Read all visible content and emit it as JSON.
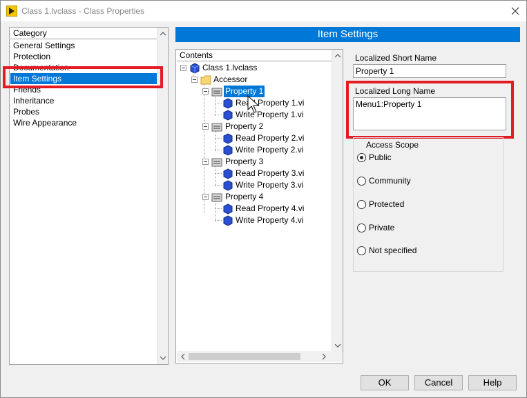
{
  "window": {
    "title": "Class 1.lvclass - Class Properties"
  },
  "category": {
    "header": "Category",
    "items": [
      {
        "label": "General Settings"
      },
      {
        "label": "Protection"
      },
      {
        "label": "Documentation"
      },
      {
        "label": "Item Settings",
        "selected": true
      },
      {
        "label": "Friends"
      },
      {
        "label": "Inheritance"
      },
      {
        "label": "Probes"
      },
      {
        "label": "Wire Appearance"
      }
    ]
  },
  "banner": {
    "title": "Item Settings"
  },
  "contents": {
    "header": "Contents",
    "tree": [
      {
        "label": "Class 1.lvclass",
        "icon": "lvclass-icon"
      },
      {
        "label": "Accessor",
        "icon": "folder-icon"
      },
      {
        "label": "Property 1",
        "icon": "property-folder-icon",
        "selected": true
      },
      {
        "label": "Read Property 1.vi",
        "icon": "vi-icon"
      },
      {
        "label": "Write Property 1.vi",
        "icon": "vi-icon"
      },
      {
        "label": "Property 2",
        "icon": "property-folder-icon"
      },
      {
        "label": "Read Property 2.vi",
        "icon": "vi-icon"
      },
      {
        "label": "Write Property 2.vi",
        "icon": "vi-icon"
      },
      {
        "label": "Property 3",
        "icon": "property-folder-icon"
      },
      {
        "label": "Read Property 3.vi",
        "icon": "vi-icon"
      },
      {
        "label": "Write Property 3.vi",
        "icon": "vi-icon"
      },
      {
        "label": "Property 4",
        "icon": "property-folder-icon"
      },
      {
        "label": "Read Property 4.vi",
        "icon": "vi-icon"
      },
      {
        "label": "Write Property 4.vi",
        "icon": "vi-icon"
      }
    ]
  },
  "settings": {
    "short_name_label": "Localized Short Name",
    "short_name_value": "Property 1",
    "long_name_label": "Localized Long Name",
    "long_name_value": "Menu1:Property 1"
  },
  "access_scope": {
    "title": "Access Scope",
    "options": [
      {
        "label": "Public",
        "checked": true
      },
      {
        "label": "Community",
        "checked": false
      },
      {
        "label": "Protected",
        "checked": false
      },
      {
        "label": "Private",
        "checked": false
      },
      {
        "label": "Not specified",
        "checked": false
      }
    ]
  },
  "buttons": {
    "ok": "OK",
    "cancel": "Cancel",
    "help": "Help"
  },
  "colors": {
    "selection": "#0078d7",
    "highlight_annotation": "#e21c25"
  }
}
